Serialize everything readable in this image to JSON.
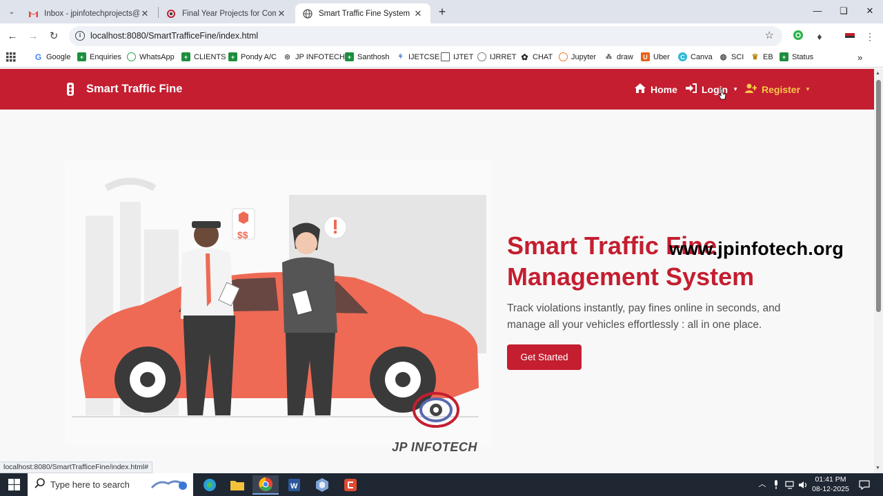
{
  "browser": {
    "tabs": [
      {
        "title": "Inbox - jpinfotechprojects@gm",
        "icon": "gmail-icon"
      },
      {
        "title": "Final Year Projects for Compute",
        "icon": "jp-logo-icon"
      },
      {
        "title": "Smart Traffic Fine System",
        "icon": "globe-icon"
      }
    ],
    "url": "localhost:8080/SmartTrafficeFine/index.html",
    "bookmarks": [
      {
        "label": "Google",
        "icon": "google-icon"
      },
      {
        "label": "Enquiries",
        "icon": "sheets-icon"
      },
      {
        "label": "WhatsApp",
        "icon": "whatsapp-icon"
      },
      {
        "label": "CLIENTS",
        "icon": "sheets-icon"
      },
      {
        "label": "Pondy A/C",
        "icon": "sheets-icon"
      },
      {
        "label": "JP INFOTECH",
        "icon": "jp-logo-icon"
      },
      {
        "label": "Santhosh",
        "icon": "sheets-icon"
      },
      {
        "label": "IJETCSE",
        "icon": "journal-icon"
      },
      {
        "label": "IJTET",
        "icon": "document-icon"
      },
      {
        "label": "IJRRET",
        "icon": "journal-icon"
      },
      {
        "label": "CHAT",
        "icon": "openai-icon"
      },
      {
        "label": "Jupyter",
        "icon": "jupyter-icon"
      },
      {
        "label": "draw",
        "icon": "draw-icon"
      },
      {
        "label": "Uber",
        "icon": "uber-icon"
      },
      {
        "label": "Canva",
        "icon": "canva-icon"
      },
      {
        "label": "SCI",
        "icon": "globe-icon"
      },
      {
        "label": "EB",
        "icon": "emblem-icon"
      },
      {
        "label": "Status",
        "icon": "sheets-icon"
      }
    ],
    "status_url": "localhost:8080/SmartTrafficeFine/index.html#"
  },
  "page": {
    "brand": "Smart Traffic Fine",
    "nav": {
      "home": "Home",
      "login": "Login",
      "register": "Register"
    },
    "hero": {
      "title_line1": "Smart Traffic Fine",
      "title_line2": "Management System",
      "description": "Track violations instantly, pay fines online in seconds, and manage all your vehicles effortlessly : all in one place.",
      "cta": "Get Started"
    },
    "watermark": "www.jpinfotech.org",
    "logo_text": "JP INFOTECH"
  },
  "taskbar": {
    "search_placeholder": "Type here to search",
    "time": "01:41 PM",
    "date": "08-12-2025"
  },
  "colors": {
    "brand_red": "#c41e30",
    "register_yellow": "#f7c948"
  }
}
